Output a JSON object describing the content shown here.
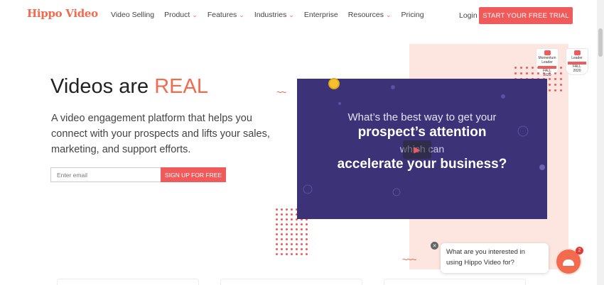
{
  "header": {
    "logo_text": "Hippo Video",
    "nav": [
      {
        "label": "Video Selling",
        "has_dropdown": false
      },
      {
        "label": "Product",
        "has_dropdown": true
      },
      {
        "label": "Features",
        "has_dropdown": true
      },
      {
        "label": "Industries",
        "has_dropdown": true
      },
      {
        "label": "Enterprise",
        "has_dropdown": false
      },
      {
        "label": "Resources",
        "has_dropdown": true
      },
      {
        "label": "Pricing",
        "has_dropdown": false
      }
    ],
    "login_label": "Login",
    "cta_label": "START YOUR FREE TRIAL"
  },
  "hero": {
    "title_plain": "Videos are ",
    "title_accent": "REAL",
    "subtitle": "A video engagement platform that helps you connect with your prospects and lifts your sales, marketing, and support efforts.",
    "email_placeholder": "Enter email",
    "signup_label": "SIGN UP FOR FREE"
  },
  "video": {
    "line1": "What’s the best way to get your",
    "line2": "prospect’s attention",
    "line3": "which can",
    "line4": "accelerate your business?",
    "play_icon": "play-icon"
  },
  "badges": [
    {
      "title": "Momentum Leader",
      "season": "FALL",
      "year": "2020"
    },
    {
      "title": "Leader",
      "season": "FALL",
      "year": "2020"
    }
  ],
  "chat": {
    "message": "What are you interested in using Hippo Video for?",
    "close_icon": "close-icon",
    "unread_count": "2"
  },
  "colors": {
    "accent": "#f26b4f",
    "cta": "#f05a5a",
    "video_bg": "#3b3277",
    "panel": "#fde6df"
  }
}
